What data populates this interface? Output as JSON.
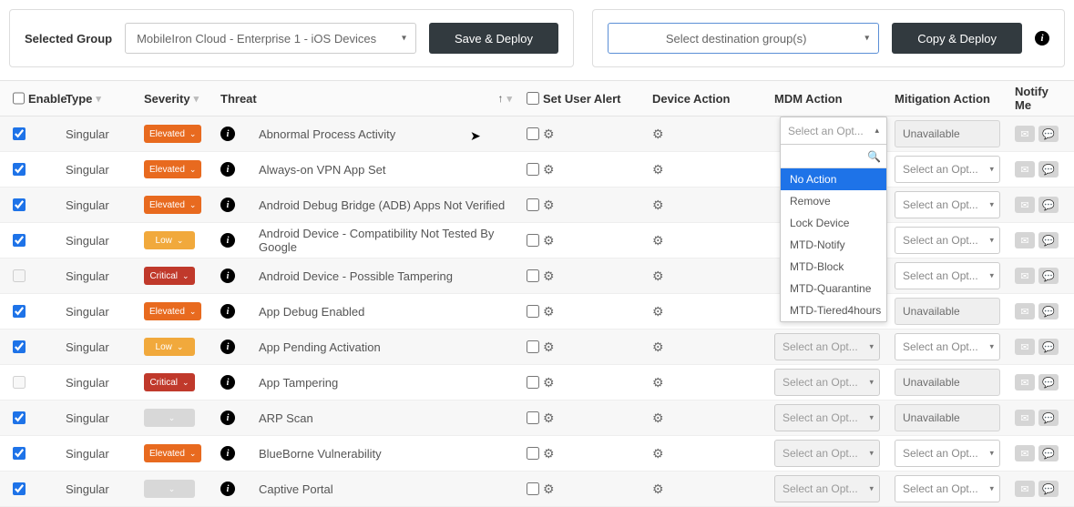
{
  "top": {
    "selected_group_label": "Selected Group",
    "selected_group_value": "MobileIron Cloud - Enterprise 1 - iOS Devices",
    "save_deploy": "Save & Deploy",
    "dest_group_placeholder": "Select destination group(s)",
    "copy_deploy": "Copy & Deploy"
  },
  "columns": {
    "enable": "Enable",
    "type": "Type",
    "severity": "Severity",
    "threat": "Threat",
    "set_user_alert": "Set User Alert",
    "device_action": "Device Action",
    "mdm_action": "MDM Action",
    "mitigation_action": "Mitigation Action",
    "notify_me": "Notify Me"
  },
  "select_opt_placeholder": "Select an Opt...",
  "unavailable_label": "Unavailable",
  "severity_labels": {
    "elevated": "Elevated",
    "low": "Low",
    "critical": "Critical",
    "none": ""
  },
  "mdm_dropdown": {
    "head": "Select an Opt...",
    "options": [
      "No Action",
      "Remove",
      "Lock Device",
      "MTD-Notify",
      "MTD-Block",
      "MTD-Quarantine",
      "MTD-Tiered4hours"
    ],
    "highlighted": 0
  },
  "rows": [
    {
      "enabled": true,
      "enable_disabled": false,
      "type": "Singular",
      "severity": "elevated",
      "threat": "Abnormal Process Activity",
      "mdm_hidden": true,
      "mitigation": "unavailable"
    },
    {
      "enabled": true,
      "enable_disabled": false,
      "type": "Singular",
      "severity": "elevated",
      "threat": "Always-on VPN App Set",
      "mdm_hidden": true,
      "mitigation": "select"
    },
    {
      "enabled": true,
      "enable_disabled": false,
      "type": "Singular",
      "severity": "elevated",
      "threat": "Android Debug Bridge (ADB) Apps Not Verified",
      "mdm_hidden": true,
      "mitigation": "select"
    },
    {
      "enabled": true,
      "enable_disabled": false,
      "type": "Singular",
      "severity": "low",
      "threat": "Android Device - Compatibility Not Tested By Google",
      "mdm_hidden": true,
      "mitigation": "select"
    },
    {
      "enabled": false,
      "enable_disabled": true,
      "type": "Singular",
      "severity": "critical",
      "threat": "Android Device - Possible Tampering",
      "mdm_hidden": true,
      "mitigation": "select"
    },
    {
      "enabled": true,
      "enable_disabled": false,
      "type": "Singular",
      "severity": "elevated",
      "threat": "App Debug Enabled",
      "mdm_hidden": true,
      "mitigation": "unavailable"
    },
    {
      "enabled": true,
      "enable_disabled": false,
      "type": "Singular",
      "severity": "low",
      "threat": "App Pending Activation",
      "mdm_hidden": false,
      "mitigation": "select"
    },
    {
      "enabled": false,
      "enable_disabled": true,
      "type": "Singular",
      "severity": "critical",
      "threat": "App Tampering",
      "mdm_hidden": false,
      "mitigation": "unavailable"
    },
    {
      "enabled": true,
      "enable_disabled": false,
      "type": "Singular",
      "severity": "none",
      "threat": "ARP Scan",
      "mdm_hidden": false,
      "mitigation": "unavailable"
    },
    {
      "enabled": true,
      "enable_disabled": false,
      "type": "Singular",
      "severity": "elevated",
      "threat": "BlueBorne Vulnerability",
      "mdm_hidden": false,
      "mitigation": "select"
    },
    {
      "enabled": true,
      "enable_disabled": false,
      "type": "Singular",
      "severity": "none",
      "threat": "Captive Portal",
      "mdm_hidden": false,
      "mitigation": "select"
    }
  ]
}
